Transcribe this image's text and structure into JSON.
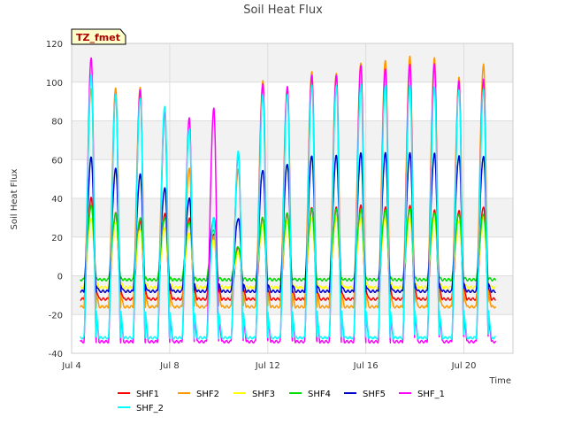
{
  "chart_data": {
    "type": "line",
    "title": "Soil Heat Flux",
    "xlabel": "Time",
    "ylabel": "Soil Heat Flux",
    "site_label": "TZ_fmet",
    "x_range": [
      "Jul 4",
      "Jul 22"
    ],
    "ylim": [
      -40,
      120
    ],
    "y_ticks": [
      -40,
      -20,
      0,
      20,
      40,
      60,
      80,
      100,
      120
    ],
    "x_ticks": [
      {
        "day": 4,
        "label": "Jul 4"
      },
      {
        "day": 8,
        "label": "Jul 8"
      },
      {
        "day": 12,
        "label": "Jul 12"
      },
      {
        "day": 16,
        "label": "Jul 16"
      },
      {
        "day": 20,
        "label": "Jul 20"
      }
    ],
    "grid": true,
    "legend_position": "bottom",
    "days": [
      4.8,
      5.8,
      6.8,
      7.8,
      8.8,
      9.8,
      10.8,
      11.8,
      12.8,
      13.8,
      14.8,
      15.8,
      16.8,
      17.8,
      18.8,
      19.8,
      20.8
    ],
    "series": [
      {
        "name": "SHF1",
        "color": "#ff0000",
        "min": -12,
        "peaks": [
          40,
          32,
          28,
          32,
          30,
          22,
          15,
          30,
          32,
          35,
          35,
          36,
          35,
          36,
          34,
          34,
          36
        ]
      },
      {
        "name": "SHF2",
        "color": "#ff9900",
        "min": -16,
        "peaks": [
          97,
          97,
          97,
          84,
          55,
          20,
          55,
          101,
          97,
          106,
          105,
          110,
          111,
          113,
          112,
          102,
          109
        ]
      },
      {
        "name": "SHF3",
        "color": "#ffff00",
        "min": -6,
        "peaks": [
          30,
          28,
          24,
          25,
          22,
          18,
          12,
          26,
          28,
          30,
          30,
          30,
          30,
          30,
          29,
          28,
          30
        ]
      },
      {
        "name": "SHF4",
        "color": "#00dd00",
        "min": -2,
        "peaks": [
          36,
          32,
          30,
          30,
          28,
          24,
          15,
          30,
          32,
          34,
          34,
          34,
          34,
          35,
          33,
          32,
          32
        ]
      },
      {
        "name": "SHF5",
        "color": "#0000cc",
        "min": -8,
        "peaks": [
          61,
          55,
          52,
          45,
          40,
          30,
          30,
          55,
          58,
          62,
          62,
          63,
          63,
          63,
          63,
          62,
          62
        ]
      },
      {
        "name": "SHF_1",
        "color": "#ff00ff",
        "min": -34,
        "peaks": [
          113,
          94,
          96,
          85,
          81,
          86,
          63,
          99,
          98,
          104,
          104,
          109,
          107,
          109,
          109,
          100,
          101
        ]
      },
      {
        "name": "SHF_2",
        "color": "#00ffff",
        "min": -32,
        "peaks": [
          104,
          94,
          92,
          88,
          76,
          30,
          64,
          93,
          93,
          98,
          98,
          99,
          99,
          99,
          98,
          96,
          96
        ]
      }
    ]
  }
}
